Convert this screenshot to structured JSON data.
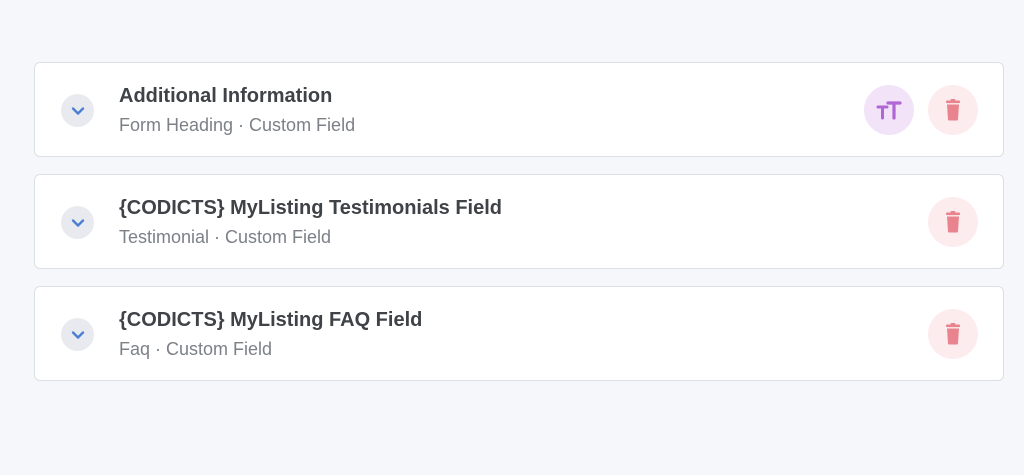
{
  "colors": {
    "background": "#f6f7fa",
    "chevron": "#4a7fd4",
    "heading_icon": "#b066d4",
    "delete_icon": "#e9848e"
  },
  "fields": [
    {
      "title": "Additional Information",
      "subtitle": "Form Heading · Custom Field",
      "toggle_icon": "chevron-down-icon",
      "actions": [
        "text-size-icon",
        "trash-icon"
      ]
    },
    {
      "title": "{CODICTS} MyListing Testimonials Field",
      "subtitle": "Testimonial · Custom Field",
      "toggle_icon": "chevron-down-icon",
      "actions": [
        "trash-icon"
      ]
    },
    {
      "title": "{CODICTS} MyListing FAQ Field",
      "subtitle": "Faq · Custom Field",
      "toggle_icon": "chevron-down-icon",
      "actions": [
        "trash-icon"
      ]
    }
  ]
}
